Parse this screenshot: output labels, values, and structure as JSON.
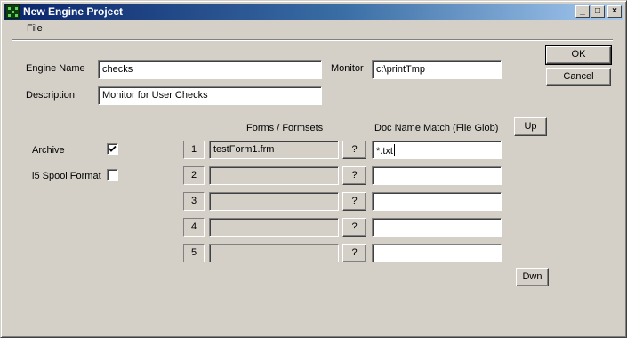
{
  "window": {
    "title": "New Engine Project",
    "controls": {
      "minimize": "_",
      "maximize": "□",
      "close": "×"
    }
  },
  "menu": {
    "items": [
      "File"
    ]
  },
  "form": {
    "engine_name_label": "Engine Name",
    "engine_name_value": "checks",
    "monitor_label": "Monitor",
    "monitor_value": "c:\\printTmp",
    "description_label": "Description",
    "description_value": "Monitor for User Checks",
    "archive_label": "Archive",
    "archive_checked": true,
    "spool_label": "i5 Spool Format",
    "spool_checked": false
  },
  "actions": {
    "ok": "OK",
    "cancel": "Cancel",
    "up": "Up",
    "down": "Dwn"
  },
  "table": {
    "forms_header": "Forms / Formsets",
    "glob_header": "Doc Name Match (File Glob)",
    "browse_label": "?",
    "rows": [
      {
        "num": "1",
        "form": "testForm1.frm",
        "glob": "*.txt"
      },
      {
        "num": "2",
        "form": "",
        "glob": ""
      },
      {
        "num": "3",
        "form": "",
        "glob": ""
      },
      {
        "num": "4",
        "form": "",
        "glob": ""
      },
      {
        "num": "5",
        "form": "",
        "glob": ""
      }
    ]
  },
  "colors": {
    "face": "#d4d0c8",
    "titlebar_start": "#0a246a",
    "titlebar_end": "#a6caf0",
    "title_icon": "#0f3d0f"
  }
}
